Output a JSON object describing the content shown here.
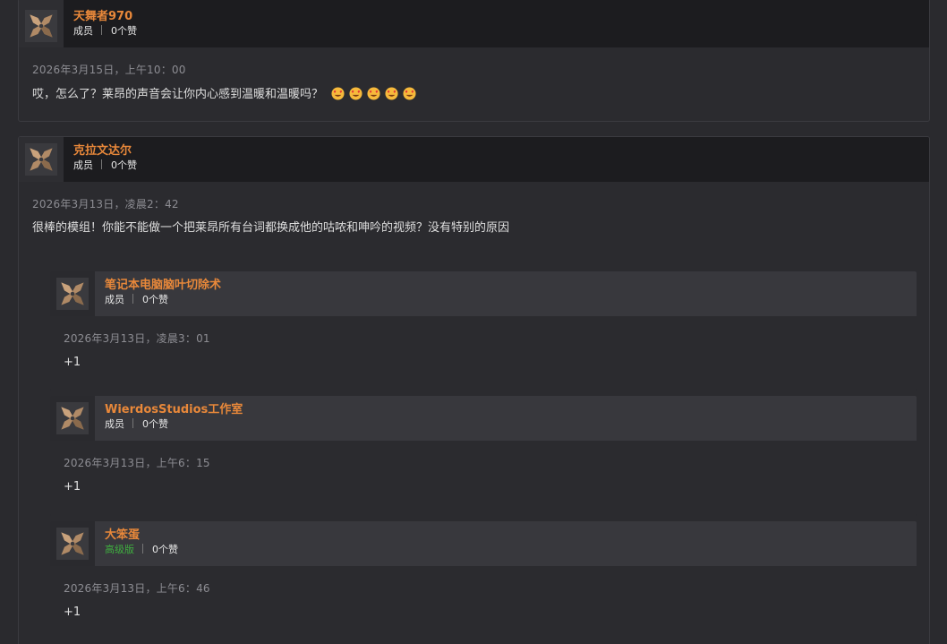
{
  "posts": [
    {
      "author": "天舞者970",
      "role": "成员",
      "likes": "0个赞",
      "date": "2026年3月15日，上午10：00",
      "text": "哎，怎么了？莱昂的声音会让你内心感到温暖和温暖吗？",
      "emoji_icon": "smiling-face-with-heart-eyes-icon",
      "emoji_count": 5
    },
    {
      "author": "克拉文达尔",
      "role": "成员",
      "likes": "0个赞",
      "date": "2026年3月13日，凌晨2：42",
      "text": "很棒的模组！你能不能做一个把莱昂所有台词都换成他的咕哝和呻吟的视频？没有特别的原因"
    }
  ],
  "replies": [
    {
      "author": "笔记本电脑脑叶切除术",
      "role": "成员",
      "likes": "0个赞",
      "date": "2026年3月13日，凌晨3：01",
      "text": "+1"
    },
    {
      "author": "WierdosStudios工作室",
      "role": "成员",
      "likes": "0个赞",
      "date": "2026年3月13日，上午6：15",
      "text": "+1"
    },
    {
      "author": "大笨蛋",
      "role": "高级版",
      "role_color": "#3fae3f",
      "likes": "0个赞",
      "date": "2026年3月13日，上午6：46",
      "text": "+1"
    }
  ],
  "colors": {
    "author_name": "#e8883a",
    "premium": "#3fae3f",
    "background": "#2a2a2e"
  }
}
